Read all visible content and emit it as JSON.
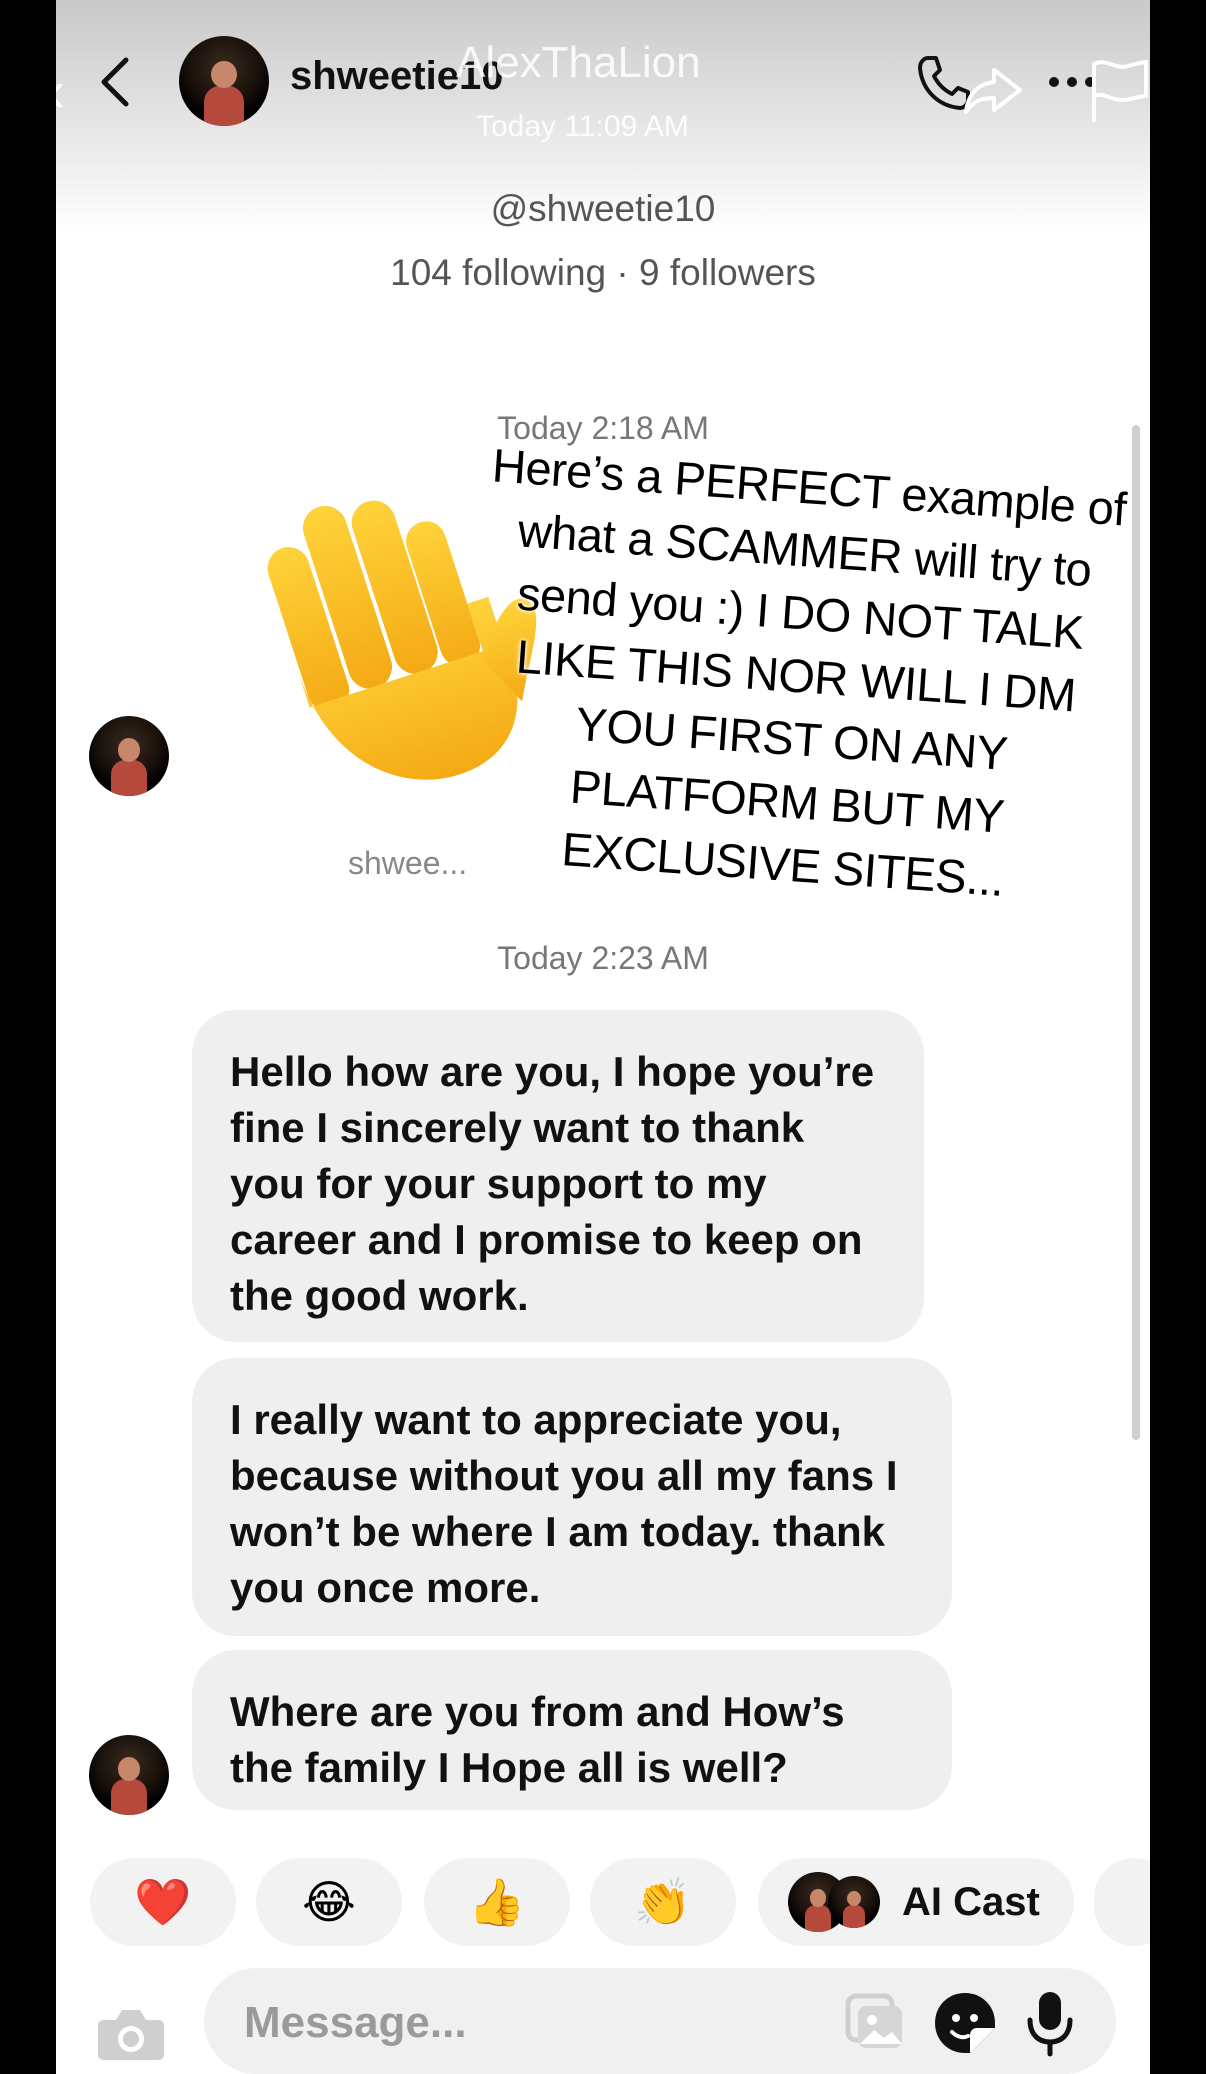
{
  "header": {
    "contact_name": "shweetie10",
    "overlay_name": "AlexThaLion",
    "overlay_time": "Today 11:09 AM"
  },
  "profile": {
    "handle": "@shweetie10",
    "counts": "104 following · 9 followers"
  },
  "conversation": {
    "timestamp_1": "Today 2:18 AM",
    "sender_label": "shwee...",
    "timestamp_2": "Today 2:23 AM",
    "messages": [
      "Hello how are you, I hope you’re fine I sincerely want to thank you for your support to my career and I promise to keep on the good work.",
      "I really want to appreciate you, because without you all my fans I won’t be where I am today. thank you once more.",
      "Where are you from and How’s the family I Hope all is well?"
    ]
  },
  "overlay_caption": "Here’s a PERFECT example of what a SCAMMER will try to send you :) I DO NOT TALK LIKE THIS NOR WILL I DM YOU FIRST ON ANY PLATFORM BUT MY EXCLUSIVE SITES...",
  "quick_reactions": {
    "items": [
      "❤️",
      "😂",
      "👍",
      "👏"
    ],
    "ai_cast_label": "AI Cast"
  },
  "composer": {
    "placeholder": "Message..."
  },
  "icons": {
    "back": "chevron-left-icon",
    "call": "phone-icon",
    "share": "share-arrow-icon",
    "more": "more-dots-icon",
    "report": "flag-icon",
    "camera": "camera-icon",
    "gallery": "gallery-icon",
    "sticker": "sticker-icon",
    "mic": "microphone-icon"
  },
  "colors": {
    "bubble": "#efefef",
    "heart": "#e0242b",
    "text": "#111111",
    "muted": "#777777"
  }
}
